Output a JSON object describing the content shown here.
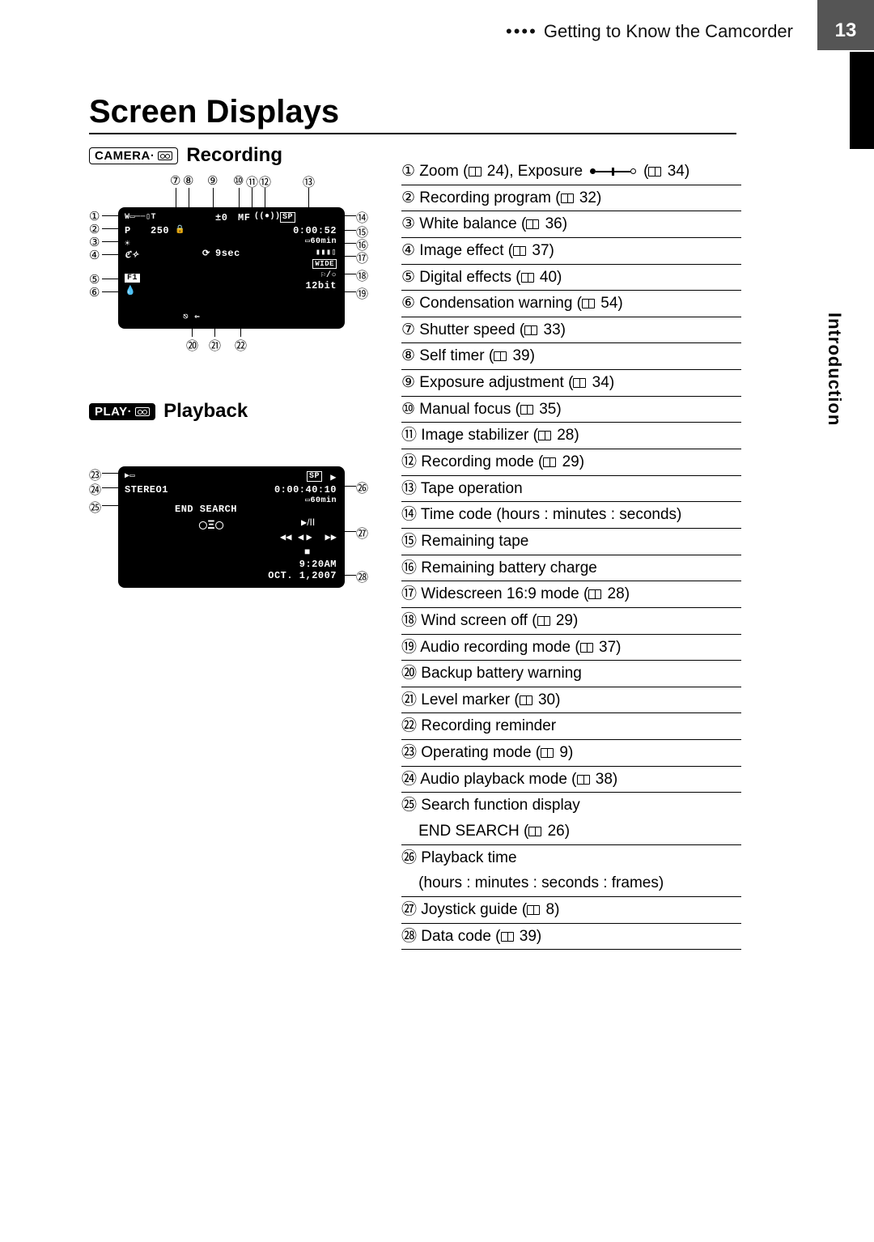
{
  "header": {
    "breadcrumb": "Getting to Know the Camcorder",
    "page_number": "13",
    "section_tab": "Introduction"
  },
  "title": "Screen Displays",
  "recording": {
    "badge_text": "CAMERA·",
    "heading": "Recording",
    "callouts_top": [
      "⑦",
      "⑧",
      "⑨",
      "⑩",
      "⑪",
      "⑫",
      "⑬"
    ],
    "callouts_left": [
      "①",
      "②",
      "③",
      "④",
      "⑤",
      "⑥"
    ],
    "callouts_right": [
      "⑭",
      "⑮",
      "⑯",
      "⑰",
      "⑱",
      "⑲"
    ],
    "callouts_bottom": [
      "⑳",
      "㉑",
      "㉒"
    ],
    "screen": {
      "line_p": "P",
      "line_shutter": "250",
      "line_exp": "±0",
      "line_mf": "MF",
      "line_sp": "SP",
      "line_tc": "0:00:52",
      "line_tape": "60min",
      "line_selftimer": "9sec",
      "line_wide": "WIDE",
      "line_audio": "12bit",
      "line_f1": "F1"
    }
  },
  "playback": {
    "badge_text": "PLAY·",
    "heading": "Playback",
    "callouts_left": [
      "㉓",
      "㉔",
      "㉕"
    ],
    "callouts_right": [
      "㉖",
      "㉗",
      "㉘"
    ],
    "screen": {
      "sp": "SP",
      "stereo": "STEREO1",
      "tc": "0:00:40:10",
      "tape": "60min",
      "endsearch": "END SEARCH",
      "time": "9:20AM",
      "date": "OCT. 1,2007",
      "joy_play": "▶/II",
      "joy_left": "◀◀",
      "joy_right": "▶▶",
      "joy_stop": "■",
      "joy_center": "◀ ▶"
    }
  },
  "legend": [
    {
      "n": "①",
      "text": "Zoom (",
      "ref": "24",
      "text2": "), Exposure ",
      "expo": true,
      "text3": " (",
      "ref2": "34",
      "text4": ")"
    },
    {
      "n": "②",
      "text": "Recording program (",
      "ref": "32",
      "text2": ")"
    },
    {
      "n": "③",
      "text": "White balance (",
      "ref": "36",
      "text2": ")"
    },
    {
      "n": "④",
      "text": "Image effect (",
      "ref": "37",
      "text2": ")"
    },
    {
      "n": "⑤",
      "text": "Digital effects (",
      "ref": "40",
      "text2": ")"
    },
    {
      "n": "⑥",
      "text": "Condensation warning (",
      "ref": "54",
      "text2": ")"
    },
    {
      "n": "⑦",
      "text": "Shutter speed (",
      "ref": "33",
      "text2": ")"
    },
    {
      "n": "⑧",
      "text": "Self timer (",
      "ref": "39",
      "text2": ")"
    },
    {
      "n": "⑨",
      "text": "Exposure adjustment (",
      "ref": "34",
      "text2": ")"
    },
    {
      "n": "⑩",
      "text": "Manual focus (",
      "ref": "35",
      "text2": ")"
    },
    {
      "n": "⑪",
      "text": "Image stabilizer (",
      "ref": "28",
      "text2": ")"
    },
    {
      "n": "⑫",
      "text": "Recording mode (",
      "ref": "29",
      "text2": ")"
    },
    {
      "n": "⑬",
      "text": "Tape operation"
    },
    {
      "n": "⑭",
      "text": "Time code (hours : minutes : seconds)"
    },
    {
      "n": "⑮",
      "text": "Remaining tape"
    },
    {
      "n": "⑯",
      "text": "Remaining battery charge"
    },
    {
      "n": "⑰",
      "text": "Widescreen 16:9 mode (",
      "ref": "28",
      "text2": ")"
    },
    {
      "n": "⑱",
      "text": "Wind screen off (",
      "ref": "29",
      "text2": ")"
    },
    {
      "n": "⑲",
      "text": "Audio recording mode (",
      "ref": "37",
      "text2": ")"
    },
    {
      "n": "⑳",
      "text": "Backup battery warning"
    },
    {
      "n": "㉑",
      "text": "Level marker (",
      "ref": "30",
      "text2": ")"
    },
    {
      "n": "㉒",
      "text": "Recording reminder"
    },
    {
      "n": "㉓",
      "text": "Operating mode (",
      "ref": "9",
      "text2": ")"
    },
    {
      "n": "㉔",
      "text": "Audio playback mode (",
      "ref": "38",
      "text2": ")"
    },
    {
      "n": "㉕",
      "text": "Search function display",
      "extra_line": "END SEARCH (",
      "extra_ref": "26",
      "extra_text2": ")"
    },
    {
      "n": "㉖",
      "text": "Playback time",
      "extra_line": "(hours : minutes : seconds : frames)"
    },
    {
      "n": "㉗",
      "text": "Joystick guide (",
      "ref": "8",
      "text2": ")"
    },
    {
      "n": "㉘",
      "text": "Data code (",
      "ref": "39",
      "text2": ")"
    }
  ]
}
